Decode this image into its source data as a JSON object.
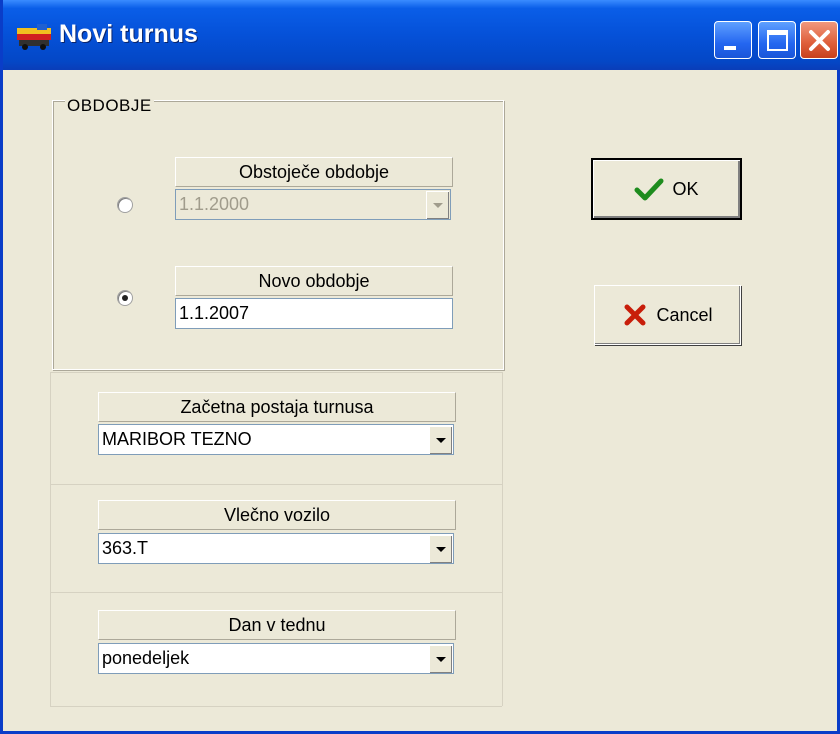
{
  "window": {
    "title": "Novi turnus",
    "title_bar_color": "#0551d8",
    "icons": {
      "app": "train-icon",
      "minimize": "minimize-icon",
      "maximize": "maximize-icon",
      "close": "close-icon"
    }
  },
  "obdobje": {
    "group_label": "OBDOBJE",
    "existing": {
      "header": "Obstoječe obdobje",
      "value": "1.1.2000",
      "selected": false,
      "disabled": true
    },
    "new": {
      "header": "Novo obdobje",
      "value": "1.1.2007",
      "selected": true
    }
  },
  "start_station": {
    "header": "Začetna postaja turnusa",
    "value": "MARIBOR TEZNO"
  },
  "vehicle": {
    "header": "Vlečno vozilo",
    "value": "363.T"
  },
  "weekday": {
    "header": "Dan v tednu",
    "value": "ponedeljek"
  },
  "buttons": {
    "ok_label": "OK",
    "ok_icon": "checkmark-icon",
    "ok_icon_color": "#1e8c1e",
    "cancel_label": "Cancel",
    "cancel_icon": "x-mark-icon",
    "cancel_icon_color": "#c81e0a"
  }
}
